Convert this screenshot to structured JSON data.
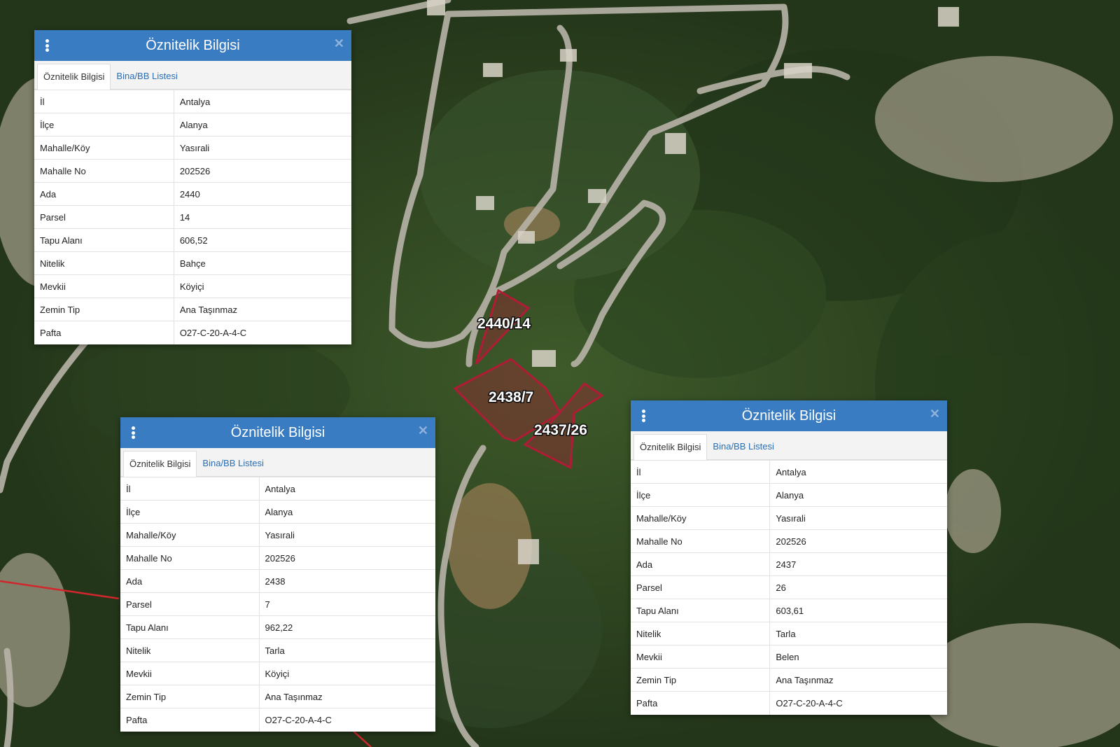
{
  "map": {
    "parcel_labels": [
      "2440/14",
      "2438/7",
      "2437/26"
    ],
    "parcel_color": "#b01c36"
  },
  "panels": [
    {
      "title": "Öznitelik Bilgisi",
      "tabs": [
        {
          "label": "Öznitelik Bilgisi",
          "active": true
        },
        {
          "label": "Bina/BB Listesi",
          "active": false
        }
      ],
      "rows": [
        {
          "k": "İl",
          "v": "Antalya"
        },
        {
          "k": "İlçe",
          "v": "Alanya"
        },
        {
          "k": "Mahalle/Köy",
          "v": "Yasırali"
        },
        {
          "k": "Mahalle No",
          "v": "202526"
        },
        {
          "k": "Ada",
          "v": "2440"
        },
        {
          "k": "Parsel",
          "v": "14"
        },
        {
          "k": "Tapu Alanı",
          "v": "606,52"
        },
        {
          "k": "Nitelik",
          "v": "Bahçe"
        },
        {
          "k": "Mevkii",
          "v": "Köyiçi"
        },
        {
          "k": "Zemin Tip",
          "v": "Ana Taşınmaz"
        },
        {
          "k": "Pafta",
          "v": "O27-C-20-A-4-C"
        }
      ]
    },
    {
      "title": "Öznitelik Bilgisi",
      "tabs": [
        {
          "label": "Öznitelik Bilgisi",
          "active": true
        },
        {
          "label": "Bina/BB Listesi",
          "active": false
        }
      ],
      "rows": [
        {
          "k": "İl",
          "v": "Antalya"
        },
        {
          "k": "İlçe",
          "v": "Alanya"
        },
        {
          "k": "Mahalle/Köy",
          "v": "Yasırali"
        },
        {
          "k": "Mahalle No",
          "v": "202526"
        },
        {
          "k": "Ada",
          "v": "2438"
        },
        {
          "k": "Parsel",
          "v": "7"
        },
        {
          "k": "Tapu Alanı",
          "v": "962,22"
        },
        {
          "k": "Nitelik",
          "v": "Tarla"
        },
        {
          "k": "Mevkii",
          "v": "Köyiçi"
        },
        {
          "k": "Zemin Tip",
          "v": "Ana Taşınmaz"
        },
        {
          "k": "Pafta",
          "v": "O27-C-20-A-4-C"
        }
      ]
    },
    {
      "title": "Öznitelik Bilgisi",
      "tabs": [
        {
          "label": "Öznitelik Bilgisi",
          "active": true
        },
        {
          "label": "Bina/BB Listesi",
          "active": false
        }
      ],
      "rows": [
        {
          "k": "İl",
          "v": "Antalya"
        },
        {
          "k": "İlçe",
          "v": "Alanya"
        },
        {
          "k": "Mahalle/Köy",
          "v": "Yasırali"
        },
        {
          "k": "Mahalle No",
          "v": "202526"
        },
        {
          "k": "Ada",
          "v": "2437"
        },
        {
          "k": "Parsel",
          "v": "26"
        },
        {
          "k": "Tapu Alanı",
          "v": "603,61"
        },
        {
          "k": "Nitelik",
          "v": "Tarla"
        },
        {
          "k": "Mevkii",
          "v": "Belen"
        },
        {
          "k": "Zemin Tip",
          "v": "Ana Taşınmaz"
        },
        {
          "k": "Pafta",
          "v": "O27-C-20-A-4-C"
        }
      ]
    }
  ]
}
